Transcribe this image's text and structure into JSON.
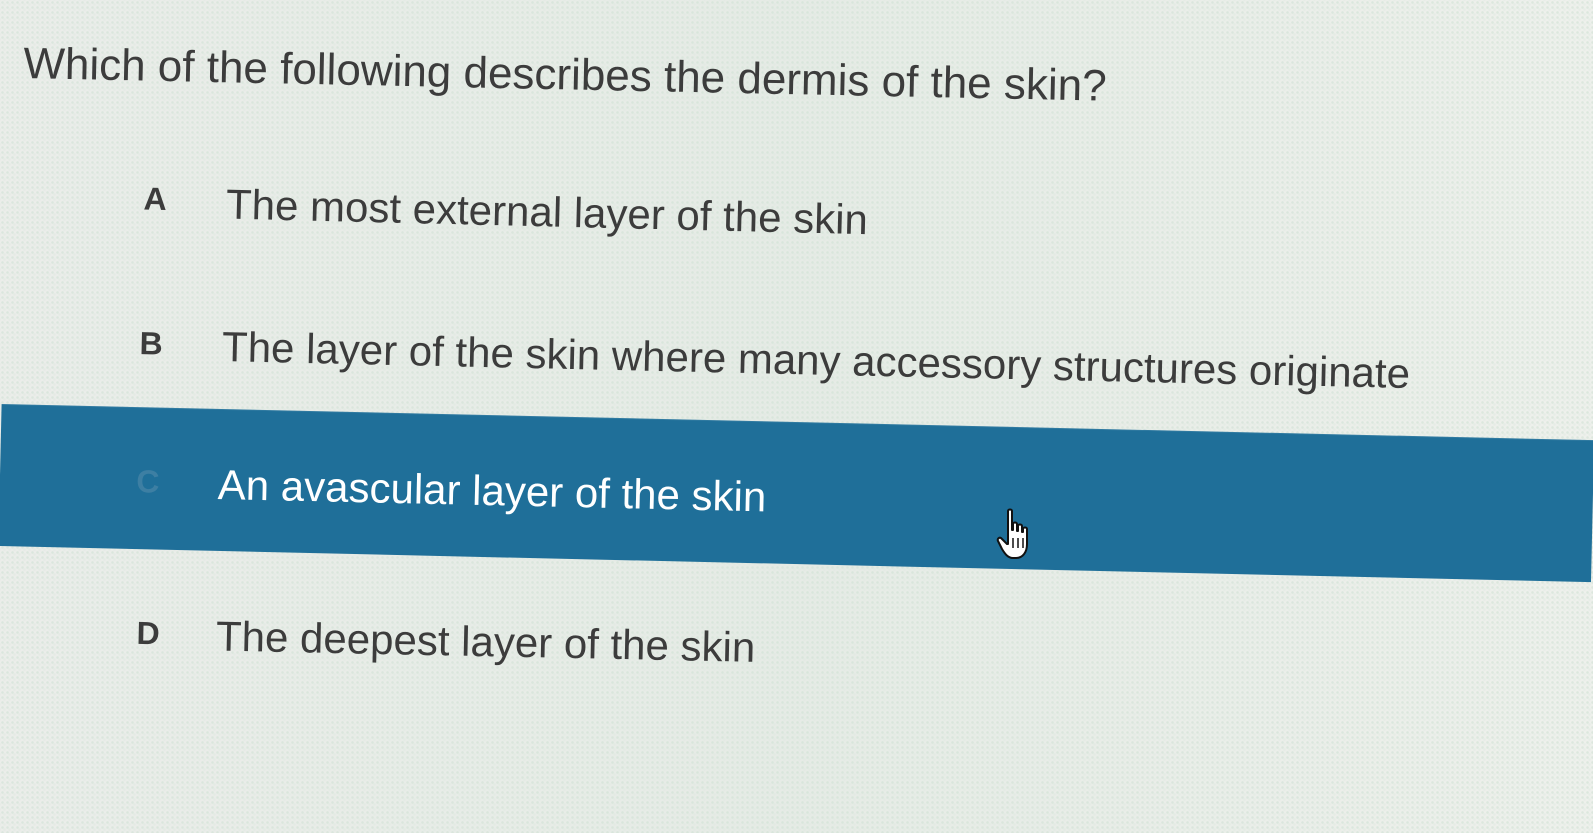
{
  "question": {
    "text": "Which of the following describes the dermis of the skin?"
  },
  "options": [
    {
      "letter": "A",
      "text": "The most external layer of the skin",
      "selected": false
    },
    {
      "letter": "B",
      "text": "The layer of the skin where many accessory structures originate",
      "selected": false
    },
    {
      "letter": "C",
      "text": "An avascular layer of the skin",
      "selected": true
    },
    {
      "letter": "D",
      "text": "The deepest layer of the skin",
      "selected": false
    }
  ],
  "colors": {
    "highlight": "#1f6f99",
    "text": "#3c3c3c",
    "highlight_text": "#ffffff",
    "background": "#eceeea"
  },
  "cursor": {
    "icon": "hand-pointer-icon"
  }
}
